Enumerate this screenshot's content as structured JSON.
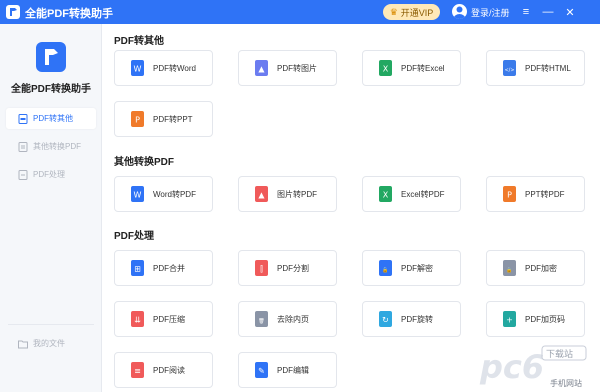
{
  "titlebar": {
    "title": "全能PDF转换助手",
    "vip_label": "开通VIP",
    "login_label": "登录/注册"
  },
  "sidebar": {
    "app_name": "全能PDF转换助手",
    "items": [
      {
        "label": "PDF转其他",
        "active": true
      },
      {
        "label": "其他转换PDF",
        "active": false
      },
      {
        "label": "PDF处理",
        "active": false
      }
    ],
    "bottom_item": "我的文件"
  },
  "sections": [
    {
      "title": "PDF转其他",
      "cards": [
        {
          "label": "PDF转Word",
          "icon": "pdf-to-word-icon",
          "color": "#2f73f6"
        },
        {
          "label": "PDF转图片",
          "icon": "pdf-to-image-icon",
          "color": "#6b7cf0"
        },
        {
          "label": "PDF转Excel",
          "icon": "pdf-to-excel-icon",
          "color": "#22a862"
        },
        {
          "label": "PDF转HTML",
          "icon": "pdf-to-html-icon",
          "color": "#3b7bea"
        },
        {
          "label": "PDF转PPT",
          "icon": "pdf-to-ppt-icon",
          "color": "#f07a2a"
        }
      ]
    },
    {
      "title": "其他转换PDF",
      "cards": [
        {
          "label": "Word转PDF",
          "icon": "word-to-pdf-icon",
          "color": "#2f73f6"
        },
        {
          "label": "图片转PDF",
          "icon": "image-to-pdf-icon",
          "color": "#f05a5a"
        },
        {
          "label": "Excel转PDF",
          "icon": "excel-to-pdf-icon",
          "color": "#22a862"
        },
        {
          "label": "PPT转PDF",
          "icon": "ppt-to-pdf-icon",
          "color": "#f07a2a"
        }
      ]
    },
    {
      "title": "PDF处理",
      "cards": [
        {
          "label": "PDF合并",
          "icon": "pdf-merge-icon",
          "color": "#2f73f6"
        },
        {
          "label": "PDF分割",
          "icon": "pdf-split-icon",
          "color": "#f05a5a"
        },
        {
          "label": "PDF解密",
          "icon": "pdf-decrypt-icon",
          "color": "#2f73f6"
        },
        {
          "label": "PDF加密",
          "icon": "pdf-encrypt-icon",
          "color": "#8a94a6"
        },
        {
          "label": "PDF压缩",
          "icon": "pdf-compress-icon",
          "color": "#f05a5a"
        },
        {
          "label": "去除内页",
          "icon": "remove-pages-icon",
          "color": "#8a94a6"
        },
        {
          "label": "PDF旋转",
          "icon": "pdf-rotate-icon",
          "color": "#2fa8e0"
        },
        {
          "label": "PDF加页码",
          "icon": "pdf-page-number-icon",
          "color": "#22a8a0"
        },
        {
          "label": "PDF阅读",
          "icon": "pdf-read-icon",
          "color": "#f05a5a"
        },
        {
          "label": "PDF编辑",
          "icon": "pdf-edit-icon",
          "color": "#2f73f6"
        }
      ]
    }
  ],
  "watermark": {
    "brand": "pc6",
    "sub1": "下载站",
    "sub2": "手机网站"
  }
}
